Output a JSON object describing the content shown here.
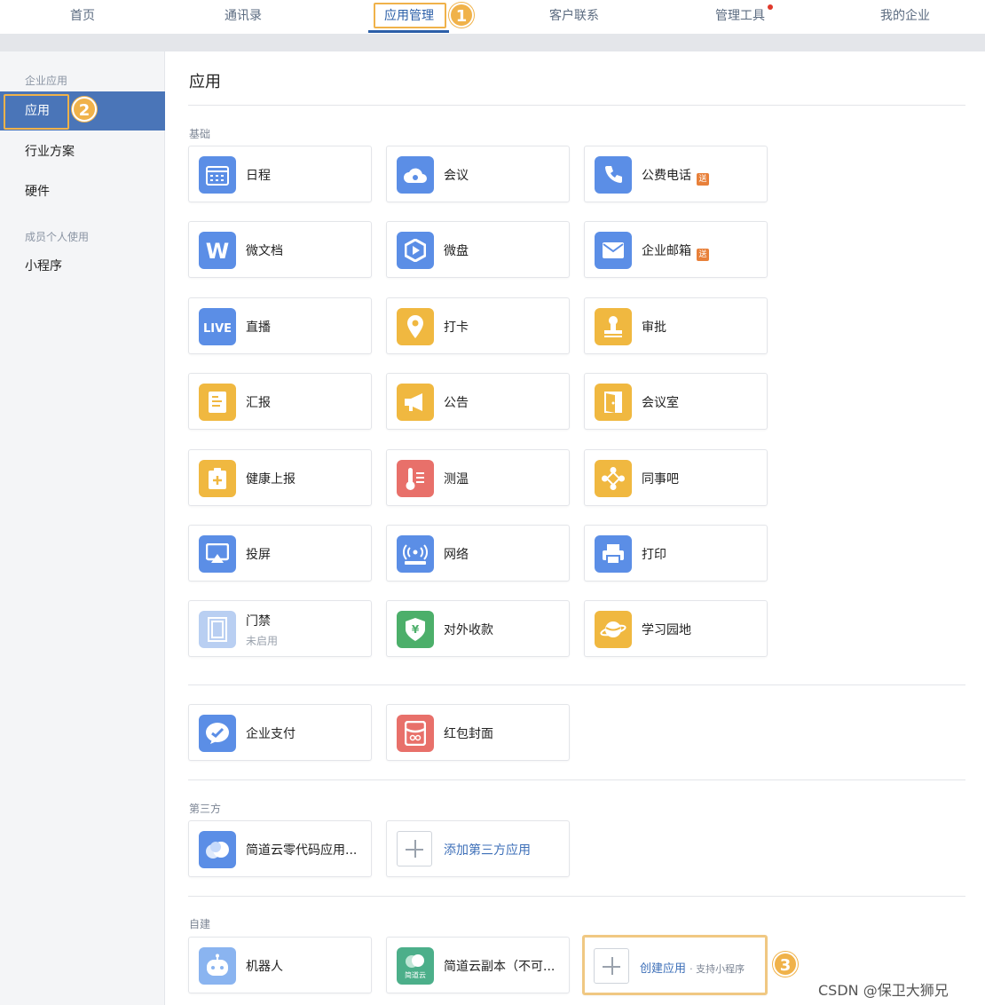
{
  "nav": {
    "items": [
      "首页",
      "通讯录",
      "应用管理",
      "客户联系",
      "管理工具",
      "我的企业"
    ],
    "active_index": 2
  },
  "callouts": [
    "1",
    "2",
    "3"
  ],
  "sidebar": {
    "section1": "企业应用",
    "items1": [
      "应用",
      "行业方案",
      "硬件"
    ],
    "section2": "成员个人使用",
    "items2": [
      "小程序"
    ]
  },
  "main": {
    "title": "应用",
    "sections": {
      "basic": "基础",
      "third": "第三方",
      "custom": "自建"
    },
    "tag_text": "送",
    "basic_apps": [
      {
        "label": "日程",
        "icon": "calendar-icon",
        "color": "#5b8ee6"
      },
      {
        "label": "会议",
        "icon": "cloud-meeting-icon",
        "color": "#5b8ee6"
      },
      {
        "label": "公费电话",
        "icon": "phone-icon",
        "color": "#5b8ee6",
        "tag": true
      },
      {
        "label": "微文档",
        "icon": "word-doc-icon",
        "color": "#5b8ee6"
      },
      {
        "label": "微盘",
        "icon": "drive-icon",
        "color": "#5b8ee6"
      },
      {
        "label": "企业邮箱",
        "icon": "mail-icon",
        "color": "#5b8ee6",
        "tag": true
      },
      {
        "label": "直播",
        "icon": "live-icon",
        "color": "#5b8ee6",
        "glyph": "LIVE"
      },
      {
        "label": "打卡",
        "icon": "location-pin-icon",
        "color": "#f0b840"
      },
      {
        "label": "审批",
        "icon": "stamp-icon",
        "color": "#f0b840"
      },
      {
        "label": "汇报",
        "icon": "report-icon",
        "color": "#f0b840"
      },
      {
        "label": "公告",
        "icon": "megaphone-icon",
        "color": "#f0b840"
      },
      {
        "label": "会议室",
        "icon": "door-icon",
        "color": "#f0b840"
      },
      {
        "label": "健康上报",
        "icon": "health-report-icon",
        "color": "#f0b840"
      },
      {
        "label": "测温",
        "icon": "thermometer-icon",
        "color": "#e8706a"
      },
      {
        "label": "同事吧",
        "icon": "colleague-icon",
        "color": "#f0b840"
      },
      {
        "label": "投屏",
        "icon": "screencast-icon",
        "color": "#5b8ee6"
      },
      {
        "label": "网络",
        "icon": "wifi-router-icon",
        "color": "#5b8ee6"
      },
      {
        "label": "打印",
        "icon": "printer-icon",
        "color": "#5b8ee6"
      },
      {
        "label": "门禁",
        "icon": "access-door-icon",
        "color": "#b9cff2",
        "sub": "未启用"
      },
      {
        "label": "对外收款",
        "icon": "payment-shield-icon",
        "color": "#4caf6a",
        "glyph": "¥"
      },
      {
        "label": "学习园地",
        "icon": "planet-icon",
        "color": "#f0b840"
      }
    ],
    "extra_apps": [
      {
        "label": "企业支付",
        "icon": "enterprise-pay-icon",
        "color": "#5b8ee6"
      },
      {
        "label": "红包封面",
        "icon": "red-packet-icon",
        "color": "#e8706a"
      }
    ],
    "third_apps": [
      {
        "label": "简道云零代码应用...",
        "icon": "jiandaoyun-cloud-icon",
        "color": "#5b8ee6"
      }
    ],
    "add_third_label": "添加第三方应用",
    "custom_apps": [
      {
        "label": "机器人",
        "icon": "robot-icon",
        "color": "#8ab4f0"
      },
      {
        "label": "简道云副本（不可...",
        "icon": "jiandaoyun-copy-icon",
        "color": "#4caf8a",
        "glyph": "简道云"
      }
    ],
    "create_label": "创建应用",
    "create_note": "· 支持小程序"
  },
  "watermark": "CSDN @保卫大狮兄"
}
